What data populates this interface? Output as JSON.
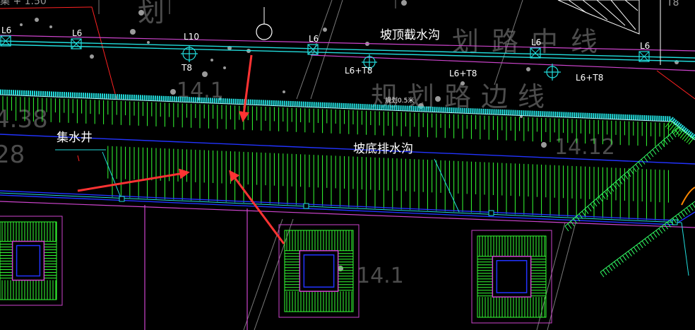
{
  "colors": {
    "background": "#000000",
    "hatch_green": "#33ff33",
    "bright_green": "#00ff66",
    "cyan": "#22dddd",
    "magenta": "#cc44cc",
    "blue": "#2222ff",
    "white": "#ffffff",
    "grey": "#8a8a8a",
    "red": "#ff2222",
    "arrow_red": "#ff3333"
  },
  "labels": {
    "slope_top_ditch": "坡顶截水沟",
    "slope_bottom_ditch": "坡底排水沟",
    "sump": "集水井",
    "road_center_watermark": "划路中线",
    "road_edge_watermark": "规划路边线",
    "plan_watermark": "划",
    "l6": "L6",
    "l10": "L10",
    "t8": "T8",
    "l6_t8": "L6+T8",
    "small_note": "规划0.5米",
    "elev_a": "14.1",
    "elev_b": "14.12",
    "elev_c": "14.1",
    "edge_a": "4.38",
    "edge_b": "28",
    "topleft_fragment": "集 + 1.50",
    "top_t8": "T8"
  },
  "icons": [
    "cross-marker-icon",
    "target-circle-icon",
    "red-arrow-icon"
  ]
}
